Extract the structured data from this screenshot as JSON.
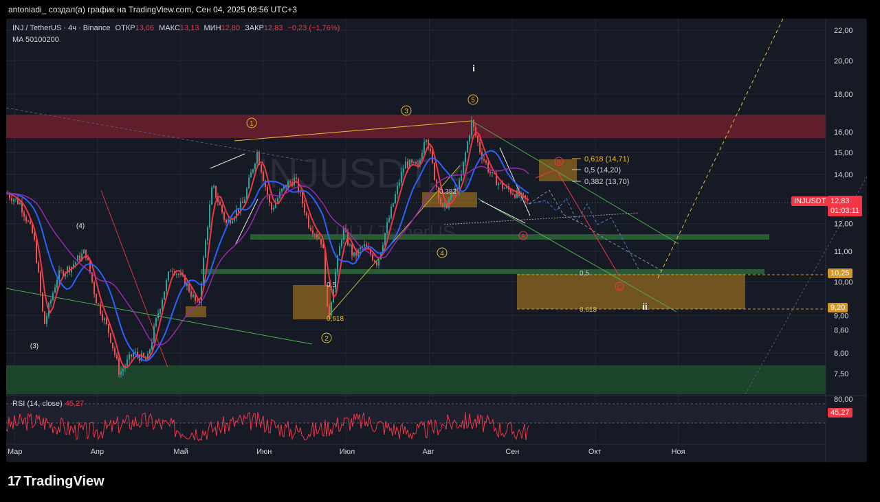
{
  "header": {
    "attribution": "antoniadi_ создал(а) график на TradingView.com, Сен 04, 2025 09:56 UTC+3"
  },
  "legend": {
    "symbol": "INJ / TetherUS · 4ч · Binance",
    "open_label": "ОТКР",
    "open": "13,06",
    "high_label": "МАКС",
    "high": "13,13",
    "low_label": "МИН",
    "low": "12,80",
    "close_label": "ЗАКР",
    "close": "12,83",
    "change": "−0,23 (−1,76%)",
    "ma": "MA 50100200",
    "rsi": "RSI (14, close)",
    "rsi_value_inline": "45,27"
  },
  "watermark": {
    "big": "INJUSDT, 4",
    "small": "INJ / TetherUS"
  },
  "price_axis": {
    "ticks": [
      "22,00",
      "20,00",
      "18,00",
      "16,00",
      "15,00",
      "14,00",
      "13,00",
      "12,00",
      "11,00",
      "10,00",
      "9,00",
      "8,60",
      "8,00",
      "7,50"
    ],
    "rsi_tick": "80,00",
    "last_symbol": "INJUSDT",
    "last_price": "12,83",
    "countdown": "01:03:11",
    "level_high": "10,25",
    "level_low": "9,20",
    "rsi_last": "45,27",
    "colors": {
      "last": "#f23645",
      "level": "#d4962a",
      "rsi": "#f23645"
    }
  },
  "time_axis": [
    "Мар",
    "Апр",
    "Май",
    "Июн",
    "Июл",
    "Авг",
    "Сен",
    "Окт",
    "Ноя"
  ],
  "fib_right": [
    {
      "text": "0,618 (14,71)"
    },
    {
      "text": "0,5 (14,20)"
    },
    {
      "text": "0,382 (13,70)"
    }
  ],
  "fib_inline": {
    "a": "0,5",
    "b": "0,618",
    "c": "0,382",
    "d": "0,5",
    "e": "0,618"
  },
  "wave_labels": {
    "w1": "1",
    "w2": "2",
    "w3": "3",
    "w4": "4",
    "w5": "5",
    "p3": "(3)",
    "p4": "(4)",
    "minor_i": "i",
    "minor_ii": "ii",
    "A": "A",
    "B": "B",
    "C": "C"
  },
  "brand": {
    "name": "TradingView",
    "mark": "17"
  },
  "chart_data": {
    "type": "line",
    "title": "INJ / TetherUS · 4ч · Binance",
    "xlabel": "",
    "ylabel": "",
    "x": [
      "Мар",
      "Апр",
      "Май",
      "Июн",
      "Июл",
      "Авг",
      "Сен"
    ],
    "ylim": [
      7.3,
      22.5
    ],
    "y_scale": "log",
    "series": [
      {
        "values": [
          13.2,
          9.0,
          7.6,
          12.3,
          14.8,
          11.0,
          10.2,
          9.0,
          14.0,
          15.8,
          16.3,
          13.0,
          12.8
        ]
      },
      {
        "values": [
          14.5,
          10.2,
          8.5,
          11.0,
          13.6,
          12.9,
          11.2,
          11.0,
          13.2,
          14.1,
          14.4,
          13.4
        ]
      },
      {
        "values": [
          15.3,
          11.0,
          8.8,
          8.6,
          11.3,
          12.2,
          12.3,
          11.3,
          11.6,
          13.4,
          13.9,
          13.4
        ]
      }
    ],
    "annotations": {
      "zones": [
        [
          15.5,
          17.2
        ],
        [
          7.3,
          7.8
        ],
        [
          11.55,
          11.7
        ],
        [
          10.3,
          10.4
        ],
        [
          9.2,
          10.25
        ]
      ],
      "fib_levels": [
        14.71,
        14.2,
        13.7
      ],
      "targets": [
        10.25,
        9.2
      ]
    },
    "rsi": {
      "last": 45.27,
      "upper": 80
    }
  }
}
